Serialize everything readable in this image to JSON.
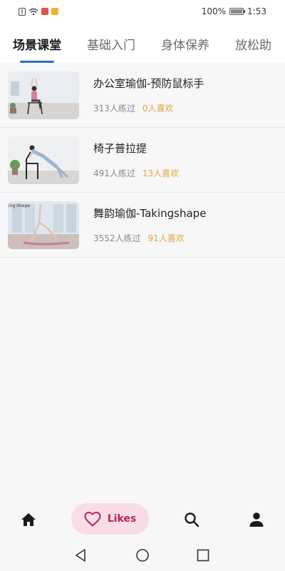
{
  "status_bar": {
    "battery_percent": "100%",
    "time": "1:53"
  },
  "tabs": [
    {
      "label": "场景课堂",
      "active": true
    },
    {
      "label": "基础入门",
      "active": false
    },
    {
      "label": "身体保养",
      "active": false
    },
    {
      "label": "放松助",
      "active": false
    }
  ],
  "courses": [
    {
      "title": "办公室瑜伽-预防鼠标手",
      "practice_count": "313人练过",
      "likes": "0人喜欢",
      "thumb_icon": "office-chair-yoga"
    },
    {
      "title": "椅子普拉提",
      "practice_count": "491人练过",
      "likes": "13人喜欢",
      "thumb_icon": "chair-pilates"
    },
    {
      "title": "舞韵瑜伽-Takingshape",
      "practice_count": "3552人练过",
      "likes": "91人喜欢",
      "thumb_icon": "dance-yoga",
      "thumb_caption": "ing Shape"
    }
  ],
  "bottom_nav": {
    "likes_label": "Likes",
    "items": [
      "home-icon",
      "heart-icon",
      "search-icon",
      "person-icon"
    ]
  },
  "colors": {
    "accent": "#2f6fc9",
    "likes_text": "#e3a33a",
    "likes_pill_bg": "#f8dde6",
    "likes_pill_text": "#b3264f"
  }
}
